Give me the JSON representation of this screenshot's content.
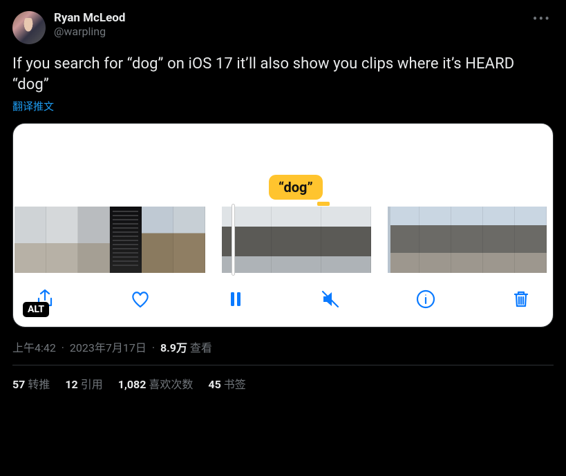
{
  "author": {
    "display_name": "Ryan McLeod",
    "handle": "@warpling"
  },
  "tweet_text": "If you search for “dog” on iOS 17 it’ll also show you clips where it’s HEARD “dog”",
  "translate_label": "翻译推文",
  "media": {
    "caption_tag": "“dog”",
    "alt_badge": "ALT"
  },
  "meta": {
    "time": "上午4:42",
    "date": "2023年7月17日",
    "views_count": "8.9万",
    "views_label": "查看"
  },
  "stats": {
    "retweets_count": "57",
    "retweets_label": "转推",
    "quotes_count": "12",
    "quotes_label": "引用",
    "likes_count": "1,082",
    "likes_label": "喜欢次数",
    "bookmarks_count": "45",
    "bookmarks_label": "书签"
  }
}
